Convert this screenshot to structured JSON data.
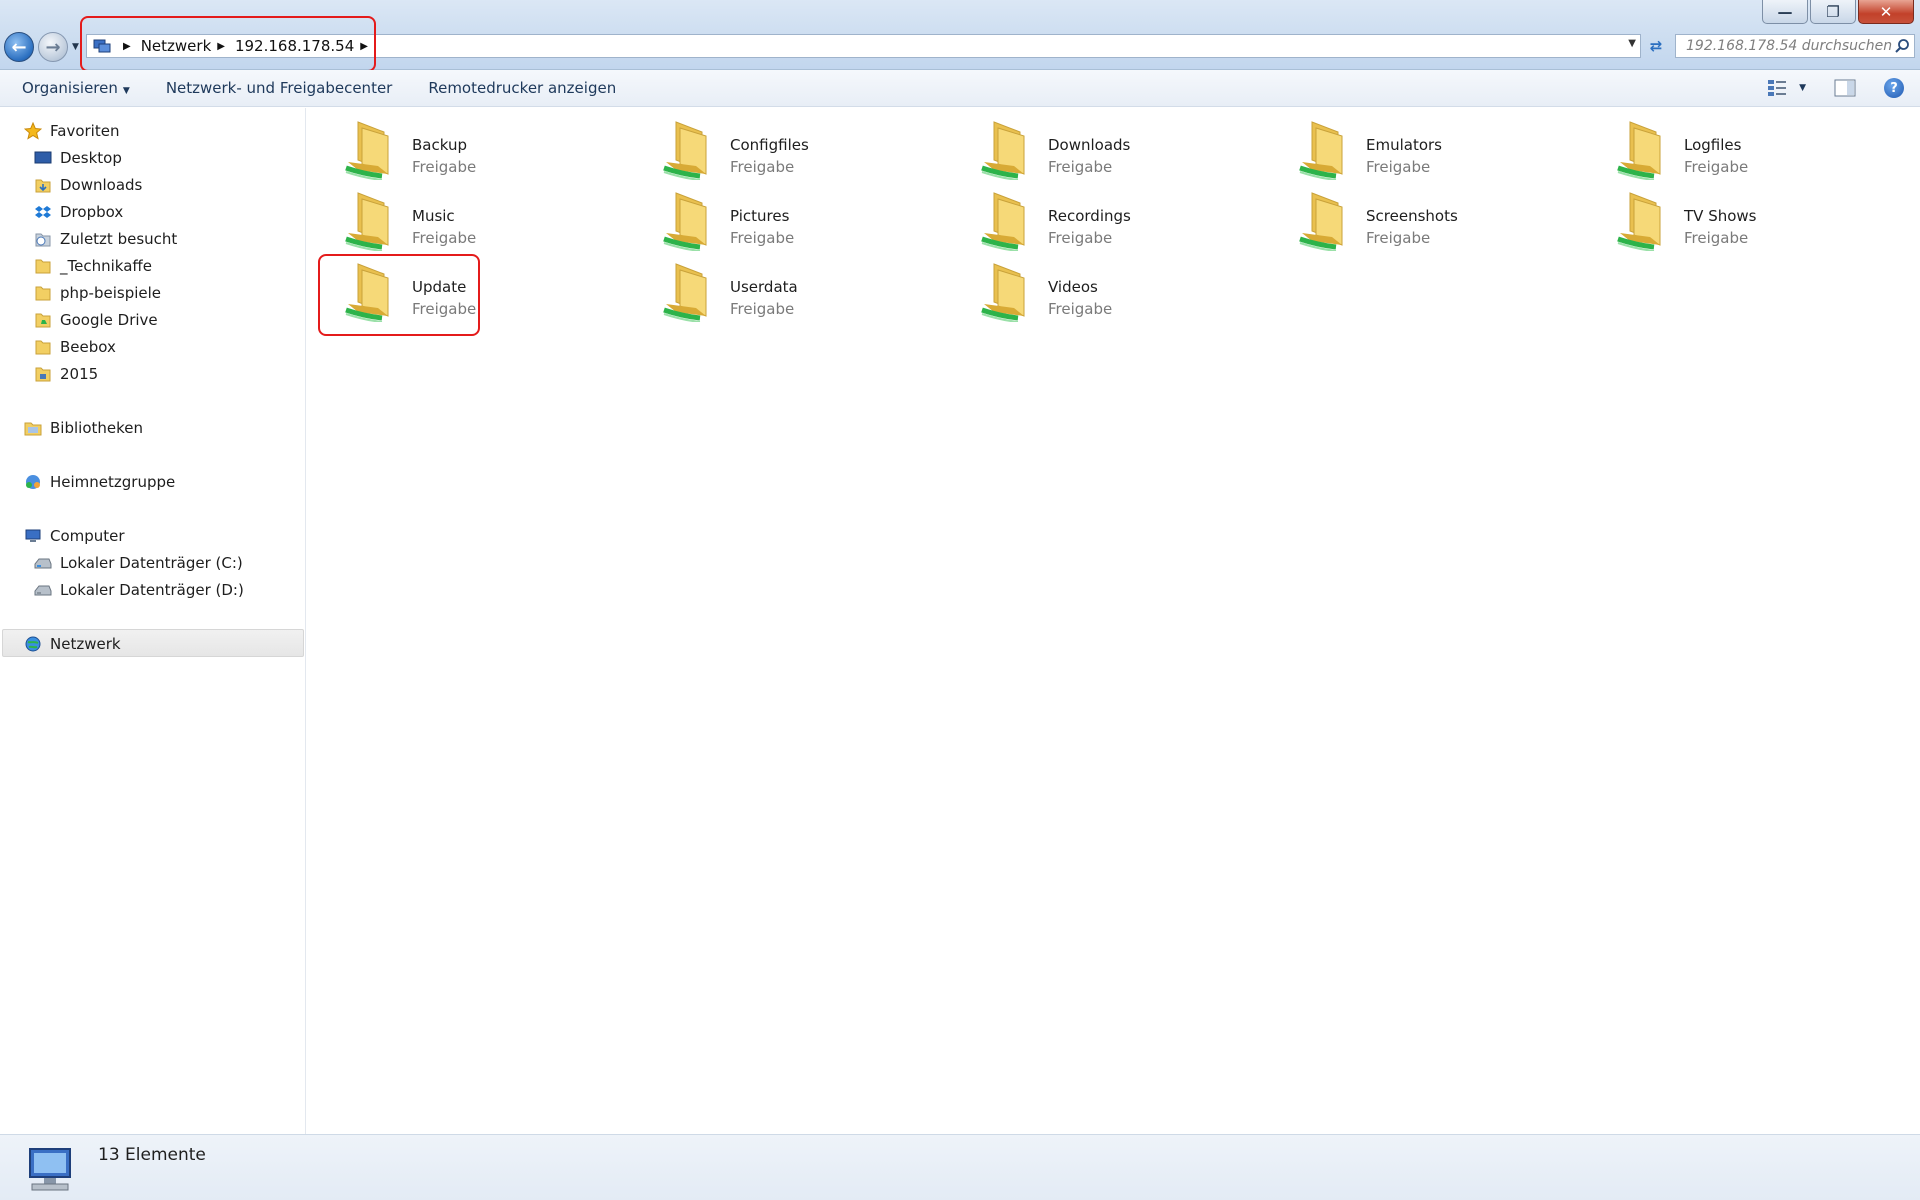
{
  "window": {
    "controls": {
      "minimize": "—",
      "maximize": "❐",
      "close": "✕"
    }
  },
  "address": {
    "crumbs": [
      "Netzwerk",
      "192.168.178.54"
    ],
    "search_placeholder": "192.168.178.54 durchsuchen"
  },
  "commandbar": {
    "organize": "Organisieren",
    "network_center": "Netzwerk- und Freigabecenter",
    "remote_printers": "Remotedrucker anzeigen"
  },
  "sidebar": {
    "favorites_header": "Favoriten",
    "favorites": [
      "Desktop",
      "Downloads",
      "Dropbox",
      "Zuletzt besucht",
      "_Technikaffe",
      "php-beispiele",
      "Google Drive",
      "Beebox",
      "2015"
    ],
    "libraries": "Bibliotheken",
    "homegroup": "Heimnetzgruppe",
    "computer": "Computer",
    "drives": [
      "Lokaler Datenträger (C:)",
      "Lokaler Datenträger (D:)"
    ],
    "network": "Netzwerk"
  },
  "shares": [
    {
      "name": "Backup",
      "type": "Freigabe"
    },
    {
      "name": "Configfiles",
      "type": "Freigabe"
    },
    {
      "name": "Downloads",
      "type": "Freigabe"
    },
    {
      "name": "Emulators",
      "type": "Freigabe"
    },
    {
      "name": "Logfiles",
      "type": "Freigabe"
    },
    {
      "name": "Music",
      "type": "Freigabe"
    },
    {
      "name": "Pictures",
      "type": "Freigabe"
    },
    {
      "name": "Recordings",
      "type": "Freigabe"
    },
    {
      "name": "Screenshots",
      "type": "Freigabe"
    },
    {
      "name": "TV Shows",
      "type": "Freigabe"
    },
    {
      "name": "Update",
      "type": "Freigabe"
    },
    {
      "name": "Userdata",
      "type": "Freigabe"
    },
    {
      "name": "Videos",
      "type": "Freigabe"
    }
  ],
  "status": {
    "count_text": "13 Elemente"
  },
  "colors": {
    "highlight": "#e41b1b",
    "folder": "#f2cf63",
    "share_pipe": "#2db34a"
  }
}
